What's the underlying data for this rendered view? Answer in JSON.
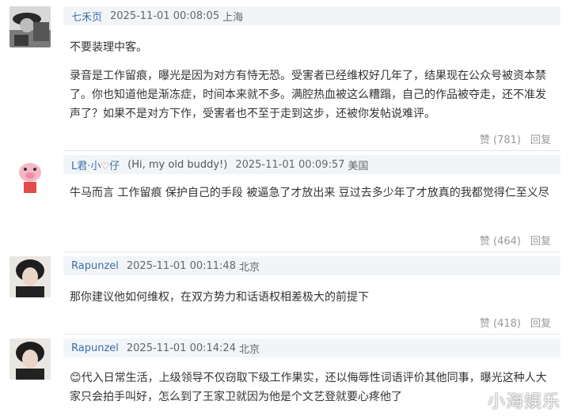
{
  "comments": [
    {
      "username": "七禾页",
      "tag": "",
      "time": "2025-11-01 00:08:05",
      "location": "上海",
      "paragraphs": [
        "不要装理中客。",
        "录音是工作留痕，曝光是因为对方有恃无恐。受害者已经维权好几年了，结果现在公众号被资本禁了。你也知道他是渐冻症，时间本来就不多。满腔热血被这么糟蹋，自己的作品被夺走，还不准发声了？如果不是对方下作，受害者也不至于走到这步，还被你发帖说难评。"
      ],
      "like": "赞 (781)",
      "reply": "回复"
    },
    {
      "username": "L君·小",
      "username_suffix": "仔",
      "tag": "(Hi, my old buddy!)",
      "time": "2025-11-01 00:09:57",
      "location": "美国",
      "paragraphs": [
        "牛马而言 工作留痕 保护自己的手段 被逼急了才放出来 豆过去多少年了才放真的我都觉得仁至义尽"
      ],
      "like": "赞 (464)",
      "reply": "回复"
    },
    {
      "username": "Rapunzel",
      "tag": "",
      "time": "2025-11-01 00:11:48",
      "location": "北京",
      "paragraphs": [
        "那你建议他如何维权，在双方势力和话语权相差极大的前提下"
      ],
      "like": "赞 (418)",
      "reply": "回复"
    },
    {
      "username": "Rapunzel",
      "tag": "",
      "time": "2025-11-01 00:14:24",
      "location": "北京",
      "paragraphs": [
        "😊代入日常生活，上级领导不仅窃取下级工作果实，还以侮辱性词语评价其他同事，曝光这种人大家只会拍手叫好，怎么到了王家卫就因为他是个文艺登就要心疼他了"
      ],
      "like": "",
      "reply": ""
    }
  ],
  "watermark": "小海娱乐",
  "colors": {
    "username": "#3b6ea8",
    "header_bg": "#f2f5f8",
    "meta": "#999999"
  }
}
